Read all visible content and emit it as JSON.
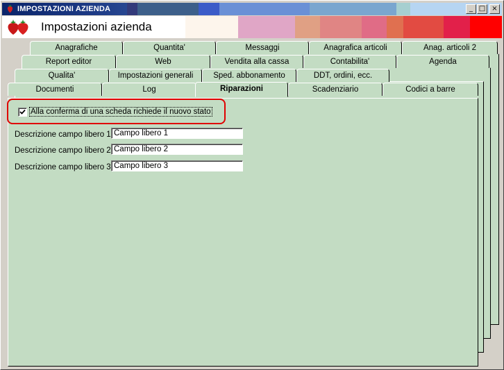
{
  "window": {
    "title": "IMPOSTAZIONI AZIENDA",
    "colors": {
      "titlebar_start": "#0a246a",
      "panel_bg": "#c3dcc3",
      "highlight": "#e00000"
    }
  },
  "header": {
    "title": "Impostazioni azienda",
    "icon": "strawberry-icon"
  },
  "title_buttons": {
    "minimize": "_",
    "maximize": "□",
    "close": "×"
  },
  "tabs": {
    "row1": [
      "Anagrafiche",
      "Quantita'",
      "Messaggi",
      "Anagrafica articoli",
      "Anag. articoli 2"
    ],
    "row2": [
      "Report editor",
      "Web",
      "Vendita alla cassa",
      "Contabilita'",
      "Agenda"
    ],
    "row3": [
      "Qualita'",
      "Impostazioni generali",
      "Sped. abbonamento",
      "DDT, ordini, ecc."
    ],
    "row4": [
      "Documenti",
      "Log",
      "Riparazioni",
      "Scadenziario",
      "Codici a barre"
    ],
    "active": "Riparazioni"
  },
  "content": {
    "checkbox_label": "Alla conferma di una scheda richiede il nuovo stato",
    "checkbox_checked": true,
    "fields": [
      {
        "label": "Descrizione campo libero 1 :",
        "value": "Campo libero 1"
      },
      {
        "label": "Descrizione campo libero 2 :",
        "value": "Campo libero 2"
      },
      {
        "label": "Descrizione campo libero 3 :",
        "value": "Campo libero 3"
      }
    ]
  }
}
